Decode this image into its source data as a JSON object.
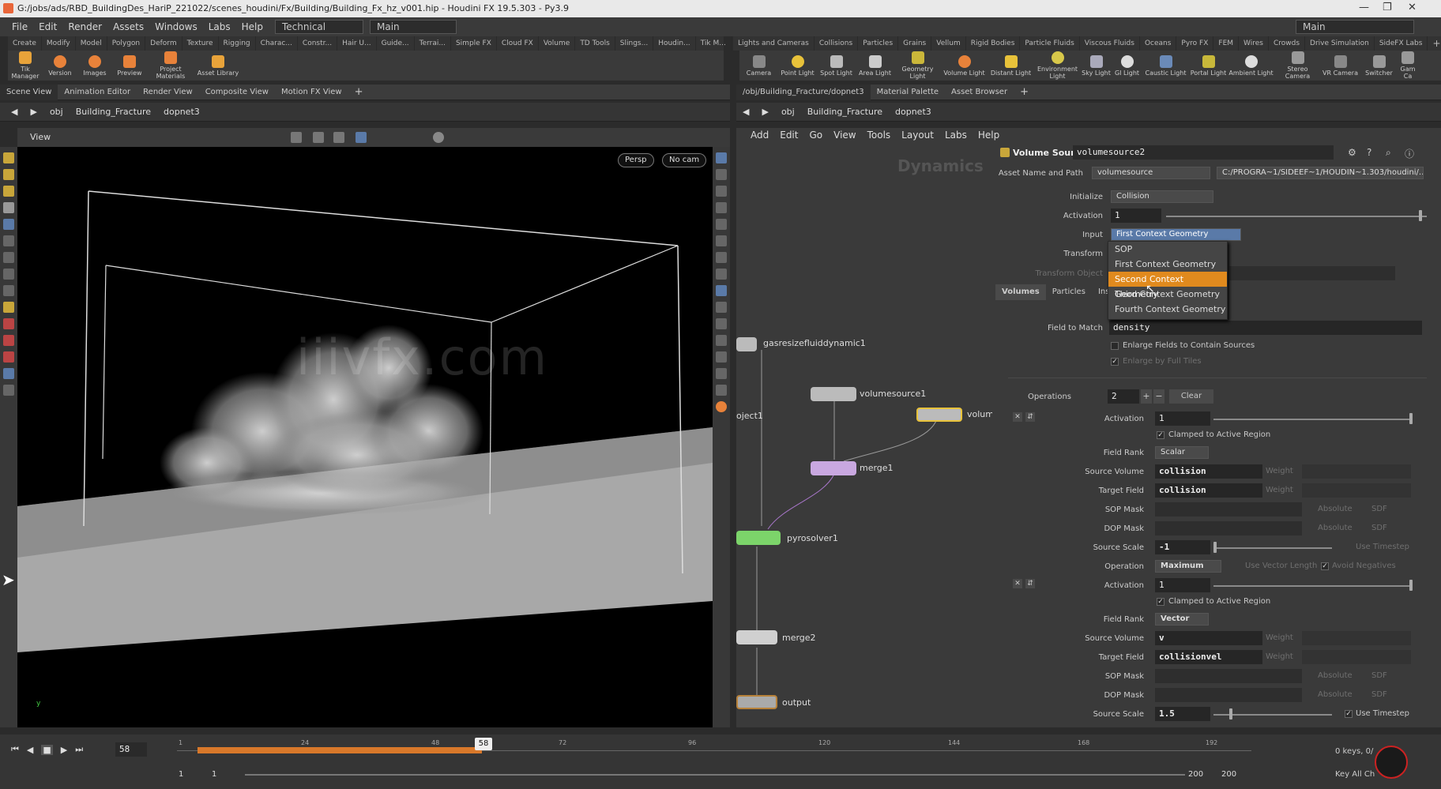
{
  "window": {
    "title": "G:/jobs/ads/RBD_BuildingDes_HariP_221022/scenes_houdini/Fx/Building/Building_Fx_hz_v001.hip - Houdini FX 19.5.303 - Py3.9"
  },
  "menubar": {
    "items": [
      "File",
      "Edit",
      "Render",
      "Assets",
      "Windows",
      "Labs",
      "Help"
    ],
    "desktop": "Technical",
    "shelf_set": "Main",
    "right_set": "Main"
  },
  "shelf_left": {
    "tabs": [
      "Create",
      "Modify",
      "Model",
      "Polygon",
      "Deform",
      "Texture",
      "Rigging",
      "Charac...",
      "Constr...",
      "Hair U...",
      "Guide...",
      "Terrai...",
      "Simple FX",
      "Cloud FX",
      "Volume",
      "TD Tools",
      "Slings...",
      "Houdin...",
      "Tik M..."
    ],
    "tools": [
      "Tik Manager",
      "Version",
      "Images",
      "Preview",
      "Project Materials",
      "Asset Library"
    ]
  },
  "shelf_right": {
    "tabs": [
      "Lights and Cameras",
      "Collisions",
      "Particles",
      "Grains",
      "Vellum",
      "Rigid Bodies",
      "Particle Fluids",
      "Viscous Fluids",
      "Oceans",
      "Pyro FX",
      "FEM",
      "Wires",
      "Crowds",
      "Drive Simulation",
      "SideFX Labs"
    ],
    "tools": [
      "Camera",
      "Point Light",
      "Spot Light",
      "Area Light",
      "Geometry Light",
      "Volume Light",
      "Distant Light",
      "Environment Light",
      "Sky Light",
      "GI Light",
      "Caustic Light",
      "Portal Light",
      "Ambient Light",
      "Stereo Camera",
      "VR Camera",
      "Switcher",
      "Gam Ca"
    ]
  },
  "left_pane": {
    "tabs": [
      "Scene View",
      "Animation Editor",
      "Render View",
      "Composite View",
      "Motion FX View"
    ],
    "path": [
      "obj",
      "Building_Fracture",
      "dopnet3"
    ],
    "viewport_label": "View",
    "persp": "Persp",
    "cam": "No cam",
    "watermark": "iiivfx.com"
  },
  "right_pane": {
    "tabs": [
      "/obj/Building_Fracture/dopnet3",
      "Material Palette",
      "Asset Browser"
    ],
    "path": [
      "obj",
      "Building_Fracture",
      "dopnet3"
    ],
    "menu": [
      "Add",
      "Edit",
      "Go",
      "View",
      "Tools",
      "Layout",
      "Labs",
      "Help"
    ],
    "context_label": "Dynamics",
    "nodes": [
      {
        "name": "gasresizefluiddynamic1"
      },
      {
        "name": "volumesource1"
      },
      {
        "name": "oject1"
      },
      {
        "name": "volum"
      },
      {
        "name": "merge1"
      },
      {
        "name": "pyrosolver1"
      },
      {
        "name": "merge2"
      },
      {
        "name": "output"
      }
    ]
  },
  "params": {
    "node_type": "Volume Source",
    "node_name": "volumesource2",
    "asset_label": "Asset Name and Path",
    "asset_name": "volumesource",
    "asset_path": "C:/PROGRA~1/SIDEEF~1/HOUDIN~1.303/houdini/...",
    "initialize_label": "Initialize",
    "initialize": "Collision",
    "activation_label": "Activation",
    "activation": "1",
    "input_label": "Input",
    "input": "First Context Geometry",
    "transform_label": "Transform",
    "transform_object_label": "Transform Object",
    "tabs": [
      "Volumes",
      "Particles",
      "Insta"
    ],
    "field_to_match_label": "Field to Match",
    "field_to_match": "density",
    "enlarge_fields": "Enlarge Fields to Contain Sources",
    "enlarge_tiles": "Enlarge by Full Tiles",
    "operations_label": "Operations",
    "operations": "2",
    "clear": "Clear",
    "ops": [
      {
        "activation": "1",
        "clamped": "Clamped to Active Region",
        "field_rank": "Scalar",
        "source_volume": "collision",
        "target_field": "collision",
        "source_scale": "-1",
        "operation": "Maximum"
      },
      {
        "activation": "1",
        "clamped": "Clamped to Active Region",
        "field_rank": "Vector",
        "source_volume": "v",
        "target_field": "collisionvel",
        "source_scale": "1.5"
      }
    ],
    "labels": {
      "field_rank": "Field Rank",
      "source_volume": "Source Volume",
      "target_field": "Target Field",
      "sop_mask": "SOP Mask",
      "dop_mask": "DOP Mask",
      "source_scale": "Source Scale",
      "operation": "Operation",
      "weight": "Weight",
      "absolute": "Absolute",
      "sdf": "SDF",
      "use_timestep": "Use Timestep",
      "use_vector_length": "Use Vector Length",
      "avoid_negatives": "Avoid Negatives",
      "activation": "Activation"
    }
  },
  "dropdown": {
    "items": [
      "SOP",
      "First Context Geometry",
      "Second Context Geometry",
      "Third Context Geometry",
      "Fourth Context Geometry"
    ],
    "selected_index": 2
  },
  "timeline": {
    "current_frame": "58",
    "ticks": [
      "1",
      "24",
      "48",
      "58",
      "72",
      "96",
      "120",
      "144",
      "168",
      "192"
    ],
    "start": "1",
    "start2": "1",
    "end": "200",
    "end2": "200",
    "keys": "0 keys, 0/",
    "key_all": "Key All Ch"
  }
}
